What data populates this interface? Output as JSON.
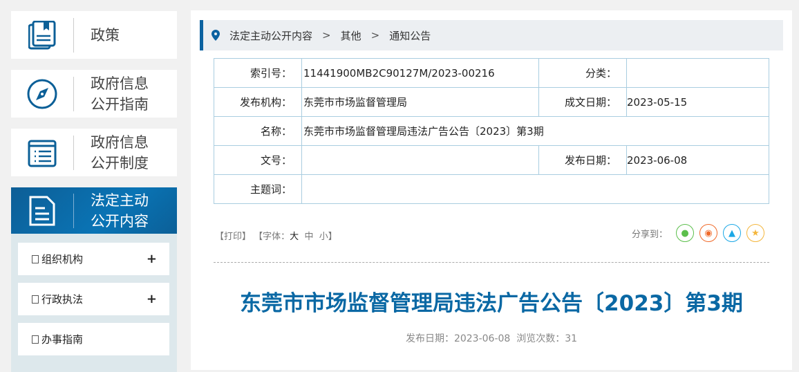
{
  "sidebar": {
    "items": [
      {
        "label1": "政策",
        "label2": ""
      },
      {
        "label1": "政府信息",
        "label2": "公开指南"
      },
      {
        "label1": "政府信息",
        "label2": "公开制度"
      },
      {
        "label1": "法定主动",
        "label2": "公开内容"
      }
    ],
    "sub_items": [
      {
        "label": "组织机构",
        "expand": "+"
      },
      {
        "label": "行政执法",
        "expand": "+"
      },
      {
        "label": "办事指南",
        "expand": ""
      }
    ]
  },
  "breadcrumb": [
    "法定主动公开内容",
    "其他",
    "通知公告"
  ],
  "info": {
    "index_label": "索引号：",
    "index": "11441900MB2C90127M/2023-00216",
    "category_label": "分类：",
    "category": "",
    "publisher_label": "发布机构：",
    "publisher": "东莞市市场监督管理局",
    "created_label": "成文日期：",
    "created": "2023-05-15",
    "name_label": "名称：",
    "name": "东莞市市场监督管理局违法广告公告〔2023〕第3期",
    "docno_label": "文号：",
    "docno": "",
    "pubdate_label": "发布日期：",
    "pubdate": "2023-06-08",
    "subject_label": "主题词：",
    "subject": ""
  },
  "tools": {
    "print": "【打印】",
    "font_prefix": "【字体：",
    "large": "大",
    "medium": "中",
    "small": "小",
    "font_suffix": "】",
    "share": "分享到："
  },
  "article": {
    "title": "东莞市市场监督管理局违法广告公告〔2023〕第3期",
    "meta": "发布日期：2023-06-08  浏览次数：31"
  },
  "colors": {
    "accent": "#0a68a4"
  }
}
